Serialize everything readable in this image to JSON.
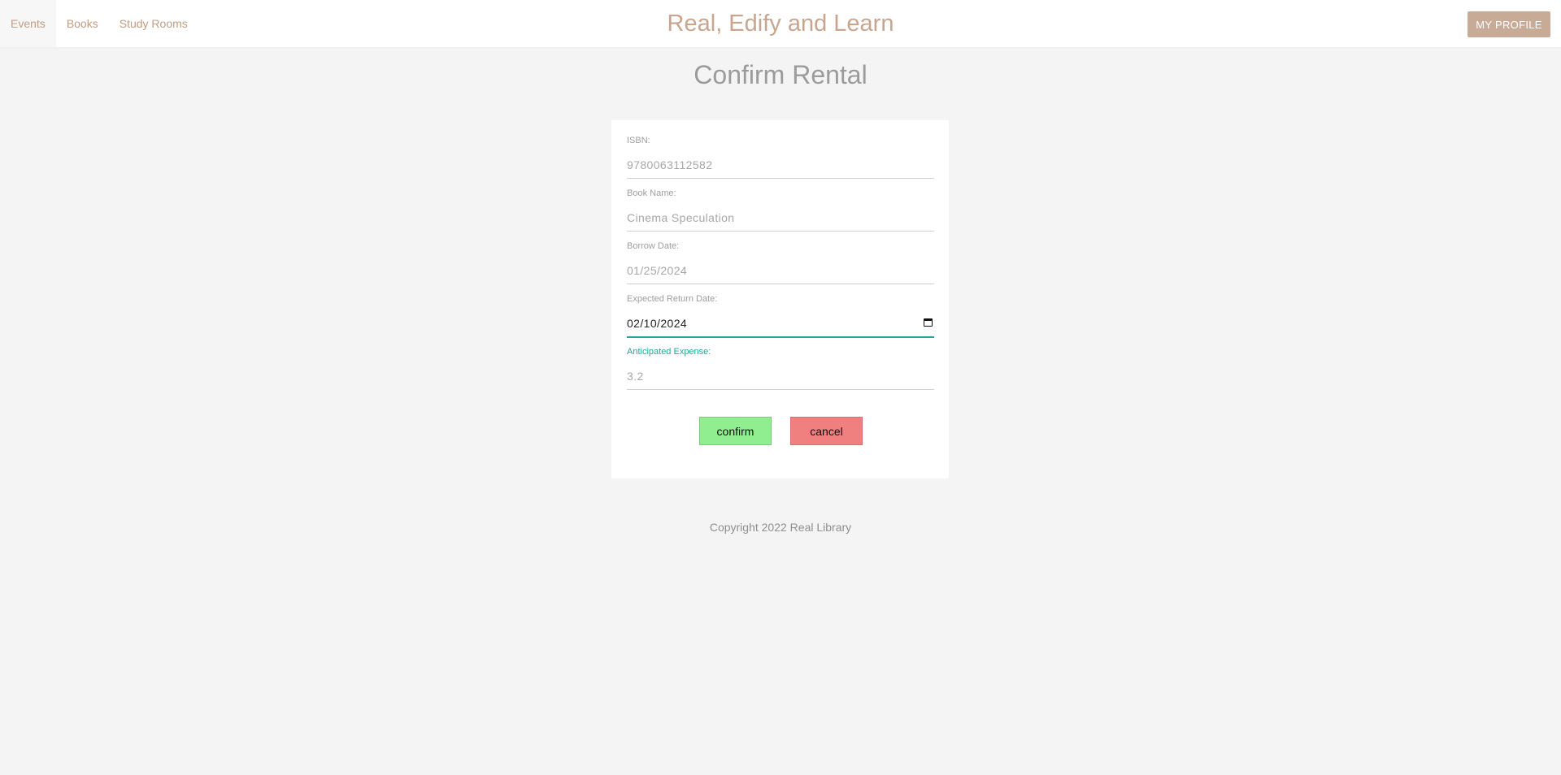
{
  "nav": {
    "items": [
      {
        "label": "Events"
      },
      {
        "label": "Books"
      },
      {
        "label": "Study Rooms"
      }
    ]
  },
  "brand": "Real, Edify and Learn",
  "profile_button": "MY PROFILE",
  "page_title": "Confirm Rental",
  "form": {
    "isbn": {
      "label": "ISBN:",
      "value": "9780063112582"
    },
    "book_name": {
      "label": "Book Name:",
      "value": "Cinema Speculation"
    },
    "borrow_date": {
      "label": "Borrow Date:",
      "value": "01/25/2024"
    },
    "return_date": {
      "label": "Expected Return Date:",
      "value": "02/10/2024"
    },
    "expense": {
      "label": "Anticipated Expense:",
      "value": "3.2"
    }
  },
  "buttons": {
    "confirm": "confirm",
    "cancel": "cancel"
  },
  "footer": "Copyright 2022 Real Library",
  "colors": {
    "accent": "#26a69a",
    "brand": "#c8a58e",
    "confirm": "#90ee90",
    "cancel": "#f08080",
    "background": "#f4f4f4"
  },
  "icons": {
    "return_date": "calendar-icon"
  }
}
